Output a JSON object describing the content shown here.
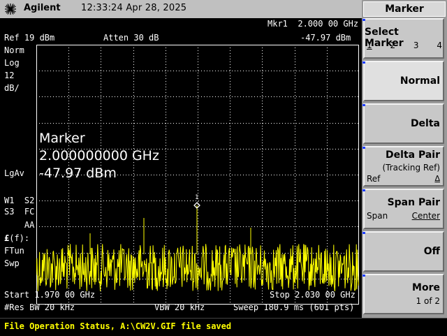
{
  "header": {
    "brand": "Agilent",
    "time": "12:33:24",
    "date": "Apr 28, 2025"
  },
  "display": {
    "marker_readout": "Mkr1  2.000 00 GHz",
    "marker_amp_top": "-47.97 dBm",
    "ref_level": "Ref 19 dBm",
    "atten": "Atten 30 dB",
    "scale_type": "Norm",
    "scale_mode": "Log",
    "scale_value": "12",
    "scale_unit": "dB/",
    "marker_label": "Marker",
    "marker_freq": "2.000000000 GHz",
    "marker_amp": "-47.97 dBm",
    "avg": "LgAv",
    "trace_line1": "W1  S2",
    "trace_line2": "S3  FC",
    "trace_line3": "    AA",
    "func_line1_prefix": "£",
    "func_line1": "(f):",
    "func_line2": "FTun",
    "func_line3": "Swp",
    "marker_number": "1",
    "start": "Start 1.970 00 GHz",
    "stop": "Stop 2.030 00 GHz",
    "res_bw": "#Res BW 20 kHz",
    "vbw": "VBW 20 kHz",
    "sweep": "Sweep 180.9 ms (601 pts)"
  },
  "status_bar": {
    "text": "File Operation Status, A:\\CW2V.GIF file saved"
  },
  "menu": {
    "title": "Marker",
    "select_marker": "Select Marker",
    "marker_nums": [
      "1",
      "2",
      "3",
      "4"
    ],
    "normal": "Normal",
    "delta": "Delta",
    "delta_pair": "Delta Pair",
    "delta_pair_sub": "(Tracking Ref)",
    "delta_pair_ref": "Ref",
    "delta_pair_sym": "Δ",
    "span_pair": "Span Pair",
    "span_pair_span": "Span",
    "span_pair_center": "Center",
    "off": "Off",
    "more": "More",
    "more_sub": "1 of 2"
  },
  "colors": {
    "trace": "#ffff00",
    "grid": "#ffffff",
    "softkey_accent": "#1f3fff"
  }
}
